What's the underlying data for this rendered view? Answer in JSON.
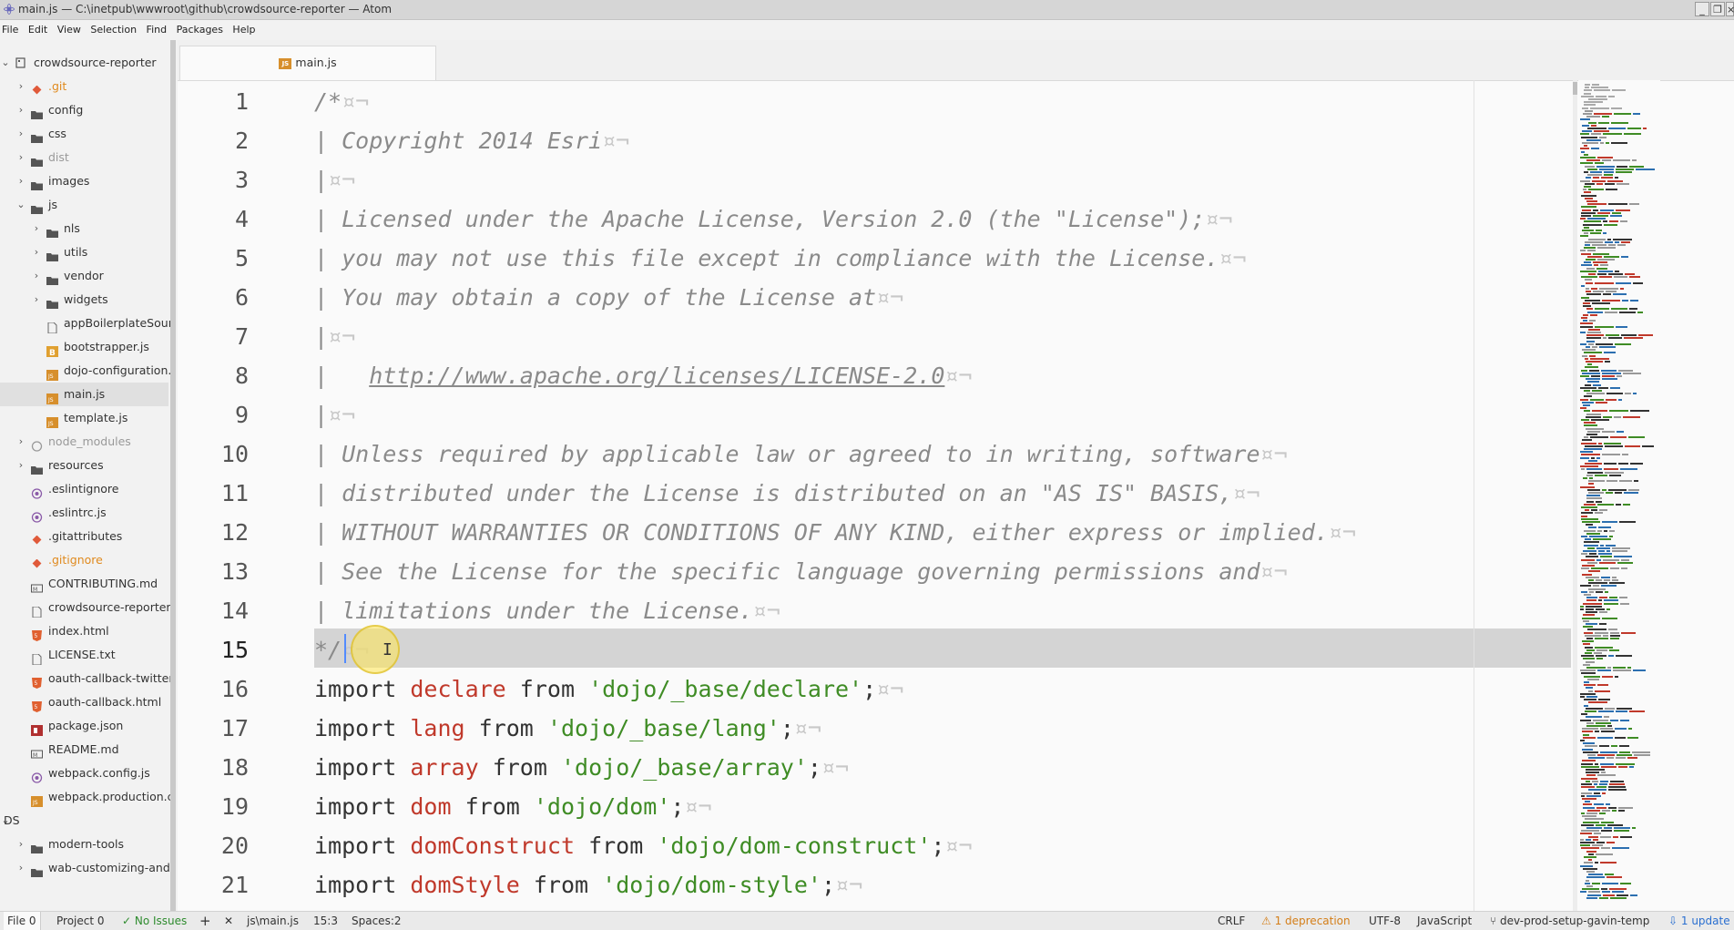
{
  "window": {
    "title": "main.js — C:\\inetpub\\wwwroot\\github\\crowdsource-reporter — Atom",
    "minimize": "_",
    "restore": "❐",
    "close": "×"
  },
  "menu": [
    "File",
    "Edit",
    "View",
    "Selection",
    "Find",
    "Packages",
    "Help"
  ],
  "tree": {
    "project": "crowdsource-reporter",
    "items": [
      {
        "label": ".git",
        "type": "git",
        "depth": 1,
        "chev": "›",
        "style": "orange"
      },
      {
        "label": "config",
        "type": "folder",
        "depth": 1,
        "chev": "›"
      },
      {
        "label": "css",
        "type": "folder",
        "depth": 1,
        "chev": "›"
      },
      {
        "label": "dist",
        "type": "folder",
        "depth": 1,
        "chev": "›",
        "style": "muted"
      },
      {
        "label": "images",
        "type": "folder",
        "depth": 1,
        "chev": "›"
      },
      {
        "label": "js",
        "type": "folder",
        "depth": 1,
        "chev": "⌄"
      },
      {
        "label": "nls",
        "type": "folder",
        "depth": 2,
        "chev": "›"
      },
      {
        "label": "utils",
        "type": "folder",
        "depth": 2,
        "chev": "›"
      },
      {
        "label": "vendor",
        "type": "folder",
        "depth": 2,
        "chev": "›"
      },
      {
        "label": "widgets",
        "type": "folder",
        "depth": 2,
        "chev": "›"
      },
      {
        "label": "appBoilerplateSourc",
        "type": "file",
        "depth": 2
      },
      {
        "label": "bootstrapper.js",
        "type": "babel",
        "depth": 2
      },
      {
        "label": "dojo-configuration.j",
        "type": "js",
        "depth": 2
      },
      {
        "label": "main.js",
        "type": "js",
        "depth": 2,
        "selected": true
      },
      {
        "label": "template.js",
        "type": "js",
        "depth": 2
      },
      {
        "label": "node_modules",
        "type": "pkg",
        "depth": 1,
        "chev": "›",
        "style": "muted"
      },
      {
        "label": "resources",
        "type": "folder",
        "depth": 1,
        "chev": "›"
      },
      {
        "label": ".eslintignore",
        "type": "cfg",
        "depth": 1
      },
      {
        "label": ".eslintrc.js",
        "type": "cfg",
        "depth": 1
      },
      {
        "label": ".gitattributes",
        "type": "git",
        "depth": 1
      },
      {
        "label": ".gitignore",
        "type": "git",
        "depth": 1,
        "style": "orange"
      },
      {
        "label": "CONTRIBUTING.md",
        "type": "md",
        "depth": 1
      },
      {
        "label": "crowdsource-reporter.j",
        "type": "file",
        "depth": 1
      },
      {
        "label": "index.html",
        "type": "html",
        "depth": 1
      },
      {
        "label": "LICENSE.txt",
        "type": "file",
        "depth": 1
      },
      {
        "label": "oauth-callback-twitter.",
        "type": "html",
        "depth": 1
      },
      {
        "label": "oauth-callback.html",
        "type": "html",
        "depth": 1
      },
      {
        "label": "package.json",
        "type": "npm",
        "depth": 1
      },
      {
        "label": "README.md",
        "type": "md",
        "depth": 1
      },
      {
        "label": "webpack.config.js",
        "type": "cfg",
        "depth": 1
      },
      {
        "label": "webpack.production.cc",
        "type": "js",
        "depth": 1
      },
      {
        "label": "DS",
        "type": "root",
        "depth": 0,
        "chev": "⌄"
      },
      {
        "label": "modern-tools",
        "type": "folder",
        "depth": 1,
        "chev": "›"
      },
      {
        "label": "wab-customizing-and-",
        "type": "folder",
        "depth": 1,
        "chev": "›"
      }
    ]
  },
  "tab": {
    "badge": "JS",
    "label": "main.js"
  },
  "editor": {
    "lines": [
      {
        "n": "1",
        "html": "<span class='cm'>/*<span class='inv'>¤¬</span></span>"
      },
      {
        "n": "2",
        "html": "<span class='cm'>| Copyright 2014 Esri<span class='inv'>¤¬</span></span>"
      },
      {
        "n": "3",
        "html": "<span class='cm'>|<span class='inv'>¤¬</span></span>"
      },
      {
        "n": "4",
        "html": "<span class='cm'>| Licensed under the Apache License, Version 2.0 (the \"License\");<span class='inv'>¤¬</span></span>"
      },
      {
        "n": "5",
        "html": "<span class='cm'>| you may not use this file except in compliance with the License.<span class='inv'>¤¬</span></span>"
      },
      {
        "n": "6",
        "html": "<span class='cm'>| You may obtain a copy of the License at<span class='inv'>¤¬</span></span>"
      },
      {
        "n": "7",
        "html": "<span class='cm'>|<span class='inv'>¤¬</span></span>"
      },
      {
        "n": "8",
        "html": "<span class='cm'>|   <span class='link'>http://www.apache.org/licenses/LICENSE-2.0</span><span class='inv'>¤¬</span></span>"
      },
      {
        "n": "9",
        "html": "<span class='cm'>|<span class='inv'>¤¬</span></span>"
      },
      {
        "n": "10",
        "html": "<span class='cm'>| Unless required by applicable law or agreed to in writing, software<span class='inv'>¤¬</span></span>"
      },
      {
        "n": "11",
        "html": "<span class='cm'>| distributed under the License is distributed on an \"AS IS\" BASIS,<span class='inv'>¤¬</span></span>"
      },
      {
        "n": "12",
        "html": "<span class='cm'>| WITHOUT WARRANTIES OR CONDITIONS OF ANY KIND, either express or implied.<span class='inv'>¤¬</span></span>"
      },
      {
        "n": "13",
        "html": "<span class='cm'>| See the License for the specific language governing permissions and<span class='inv'>¤¬</span></span>"
      },
      {
        "n": "14",
        "html": "<span class='cm'>| limitations under the License.<span class='inv'>¤¬</span></span>"
      },
      {
        "n": "15",
        "html": "<span class='cm'>*/<span class='inv'>¤¬</span></span>"
      },
      {
        "n": "16",
        "html": "<span class='kw'>import</span> <span class='var'>declare</span> <span class='kw'>from</span> <span class='str'>'dojo/_base/declare'</span>;<span class='inv'>¤¬</span>"
      },
      {
        "n": "17",
        "html": "<span class='kw'>import</span> <span class='var'>lang</span> <span class='kw'>from</span> <span class='str'>'dojo/_base/lang'</span>;<span class='inv'>¤¬</span>"
      },
      {
        "n": "18",
        "html": "<span class='kw'>import</span> <span class='var'>array</span> <span class='kw'>from</span> <span class='str'>'dojo/_base/array'</span>;<span class='inv'>¤¬</span>"
      },
      {
        "n": "19",
        "html": "<span class='kw'>import</span> <span class='var'>dom</span> <span class='kw'>from</span> <span class='str'>'dojo/dom'</span>;<span class='inv'>¤¬</span>"
      },
      {
        "n": "20",
        "html": "<span class='kw'>import</span> <span class='var'>domConstruct</span> <span class='kw'>from</span> <span class='str'>'dojo/dom-construct'</span>;<span class='inv'>¤¬</span>"
      },
      {
        "n": "21",
        "html": "<span class='kw'>import</span> <span class='var'>domStyle</span> <span class='kw'>from</span> <span class='str'>'dojo/dom-style'</span>;<span class='inv'>¤¬</span>"
      }
    ],
    "active_line": "15",
    "ibeam": "I"
  },
  "status": {
    "file_tab": "File 0",
    "project_tab": "Project 0",
    "issues": "✓ No Issues",
    "add": "+",
    "close": "✕",
    "path": "js\\main.js",
    "cursor": "15:3",
    "spaces": "Spaces:2",
    "line_ending": "CRLF",
    "deprecation": "⚠ 1 deprecation",
    "encoding": "UTF-8",
    "grammar": "JavaScript",
    "branch": "⑂ dev-prod-setup-gavin-temp",
    "update": "⇩ 1 update"
  },
  "colors": {
    "folder": "#555555",
    "js_badge": "#d78f2c",
    "git_icon": "#e05a3a",
    "comment": "#8a8a8a",
    "string": "#3f8c25",
    "variable": "#c0392b"
  }
}
